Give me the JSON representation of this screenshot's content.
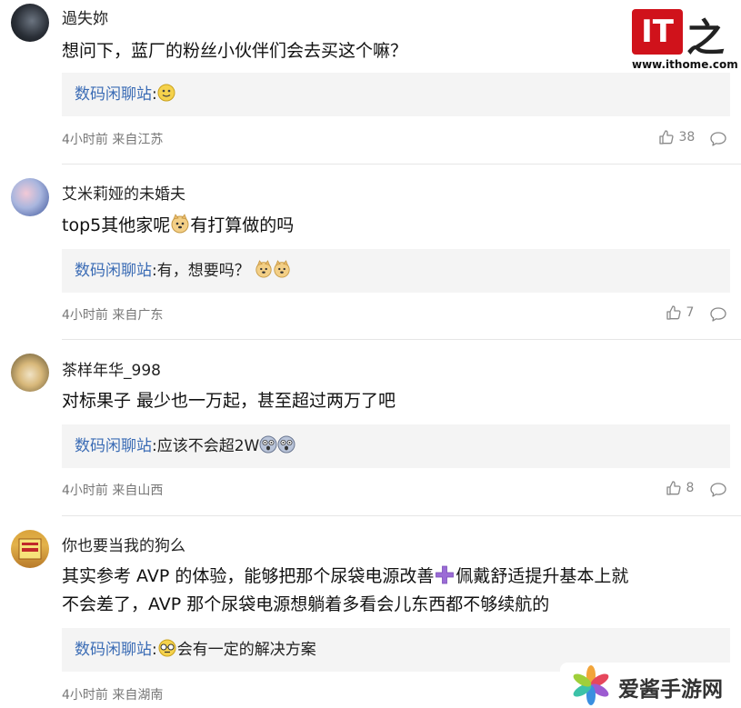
{
  "logo": {
    "url": "www.ithome.com"
  },
  "watermark": {
    "text": "爱酱手游网"
  },
  "reply_icon": "comment-bubble-icon",
  "like_icon": "thumbs-up-icon",
  "comments": [
    {
      "username": "過失妳",
      "text": "想问下，蓝厂的粉丝小伙伴们会去买这个嘛？",
      "reply_name": "数码闲聊站",
      "reply_text": ":",
      "time": "4小时前 来自江苏",
      "likes": "38"
    },
    {
      "username": "艾米莉娅的未婚夫",
      "text_a": "top5其他家呢",
      "text_b": "有打算做的吗",
      "reply_name": "数码闲聊站",
      "reply_text": ":有，想要吗？",
      "time": "4小时前 来自广东",
      "likes": "7"
    },
    {
      "username": "茶样年华_998",
      "text": "对标果子 最少也一万起，甚至超过两万了吧",
      "reply_name": "数码闲聊站",
      "reply_text": ":应该不会超2W",
      "time": "4小时前 来自山西",
      "likes": "8"
    },
    {
      "username": "你也要当我的狗么",
      "text_line1_a": "其实参考 AVP 的体验，能够把那个尿袋电源改善",
      "text_line1_b": "佩戴舒适提升基本上就",
      "text_line2": "不会差了，AVP 那个尿袋电源想躺着多看会儿东西都不够续航的",
      "reply_name": "数码闲聊站",
      "reply_text_a": ":",
      "reply_text_b": "会有一定的解决方案",
      "time": "4小时前 来自湖南"
    }
  ]
}
